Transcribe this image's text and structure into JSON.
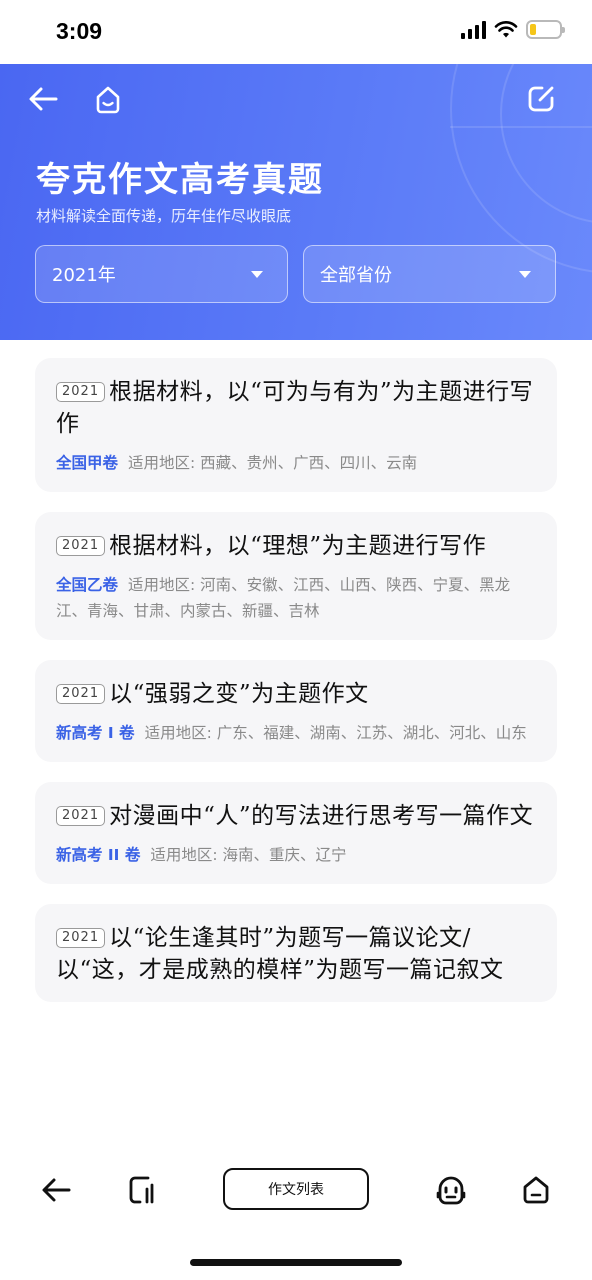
{
  "status_bar": {
    "time": "3:09",
    "battery_level": 0.2,
    "battery_color": "#f5c518"
  },
  "header": {
    "title": "夸克作文高考真题",
    "subtitle": "材料解读全面传递，历年佳作尽收眼底",
    "background": "#4a67f2",
    "filters": {
      "year": "2021年",
      "province": "全部省份"
    }
  },
  "essays": [
    {
      "year": "2021",
      "title": "根据材料，以“可为与有为”为主题进行写作",
      "paper": "全国甲卷",
      "regions": "适用地区: 西藏、贵州、广西、四川、云南"
    },
    {
      "year": "2021",
      "title": "根据材料，以“理想”为主题进行写作",
      "paper": "全国乙卷",
      "regions": "适用地区: 河南、安徽、江西、山西、陕西、宁夏、黑龙江、青海、甘肃、内蒙古、新疆、吉林"
    },
    {
      "year": "2021",
      "title": "以“强弱之变”为主题作文",
      "paper": "新高考 I 卷",
      "regions": "适用地区: 广东、福建、湖南、江苏、湖北、河北、山东"
    },
    {
      "year": "2021",
      "title": "对漫画中“人”的写法进行思考写一篇作文",
      "paper": "新高考 II 卷",
      "regions": "适用地区: 海南、重庆、辽宁"
    },
    {
      "year": "2021",
      "title": "以“论生逢其时”为题写一篇议论文/以“这，才是成熟的模样”为题写一篇记叙文",
      "paper": "",
      "regions": ""
    }
  ],
  "toolbar": {
    "center_label": "作文列表"
  },
  "icons": {
    "back": "arrow-left-icon",
    "home": "smile-home-icon",
    "edit": "edit-icon",
    "tabs": "tabs-icon",
    "robot": "robot-icon",
    "home_bottom": "home-icon"
  },
  "colors": {
    "accent": "#3a62e6",
    "card_bg": "#f6f6f8"
  }
}
